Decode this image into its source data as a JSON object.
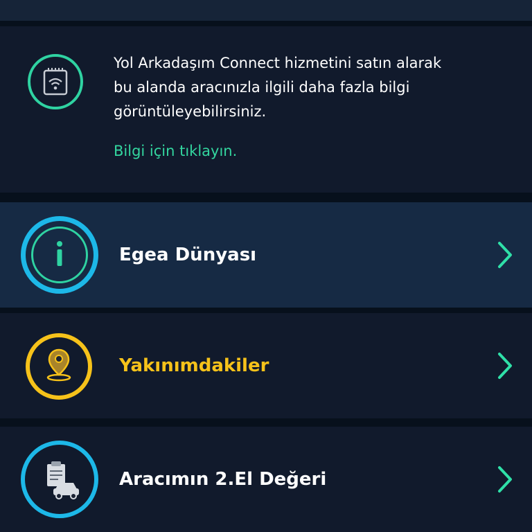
{
  "info_card": {
    "message": "Yol Arkadaşım Connect hizmetini satın alarak bu alanda aracınızla ilgili daha fazla bilgi görüntüleyebilirsiniz.",
    "link_text": "Bilgi için tıklayın.",
    "icon": "wifi-device-icon",
    "accent_color": "#2fd3a2"
  },
  "menu": {
    "items": [
      {
        "label": "Egea Dünyası",
        "icon": "info-icon",
        "accent": "#1db8e8",
        "active": true
      },
      {
        "label": "Yakınımdakiler",
        "icon": "location-pin-icon",
        "accent": "#f6c21a",
        "active": false
      },
      {
        "label": "Aracımın 2.El Değeri",
        "icon": "car-document-icon",
        "accent": "#1db8e8",
        "active": false
      }
    ]
  },
  "colors": {
    "background": "#0b1220",
    "card": "#111a2c",
    "active_row": "#162a44",
    "chevron": "#2fe0a8"
  }
}
